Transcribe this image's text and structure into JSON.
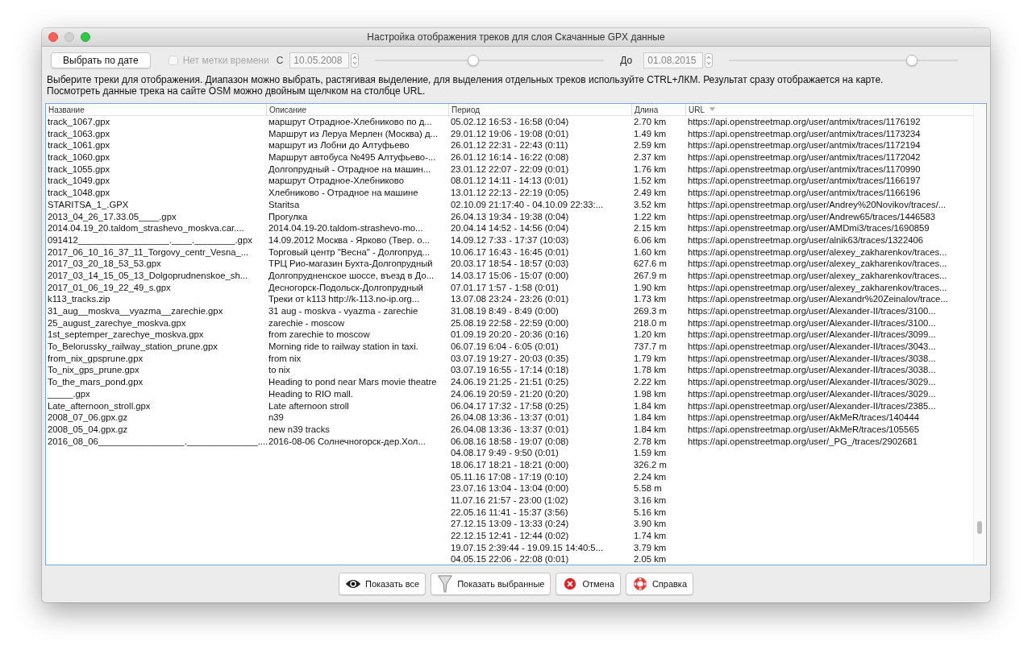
{
  "window": {
    "title": "Настройка отображения треков для слоя Скачанные GPX данные"
  },
  "filter": {
    "date_button": "Выбрать по дате",
    "no_timestamp": {
      "label": "Нет метки времени",
      "checked": false,
      "disabled": true
    },
    "from_label": "С",
    "from_date": "10.05.2008",
    "from_slider": {
      "level": 0.43
    },
    "to_label": "До",
    "to_date": "01.08.2015",
    "to_slider": {
      "level": 0.8
    }
  },
  "instructions": [
    "Выберите треки для отображения. Диапазон можно выбрать, растягивая выделение, для выделения отдельных треков используйте CTRL+ЛКМ. Результат сразу отображается на карте.",
    "Посмотреть данные трека на сайте OSM можно двойным щелчком на столбце URL."
  ],
  "table": {
    "columns": [
      {
        "label": "Название",
        "sorted": false
      },
      {
        "label": "Описание",
        "sorted": false
      },
      {
        "label": "Период",
        "sorted": false
      },
      {
        "label": "Длина",
        "sorted": false
      },
      {
        "label": "URL",
        "sorted": true
      }
    ],
    "rows": [
      {
        "name": "track_1067.gpx",
        "description": "маршрут Отрадное-Хлебниково по д...",
        "period": "05.02.12 16:53 - 16:58 (0:04)",
        "length": "2.70 km",
        "url": "https://api.openstreetmap.org/user/antmix/traces/1176192"
      },
      {
        "name": "track_1063.gpx",
        "description": "Маршрут из Леруа Мерлен (Москва) д...",
        "period": "29.01.12 19:06 - 19:08 (0:01)",
        "length": "1.49 km",
        "url": "https://api.openstreetmap.org/user/antmix/traces/1173234"
      },
      {
        "name": "track_1061.gpx",
        "description": "маршрут из Лобни до Алтуфьево",
        "period": "26.01.12 22:31 - 22:43 (0:11)",
        "length": "2.59 km",
        "url": "https://api.openstreetmap.org/user/antmix/traces/1172194"
      },
      {
        "name": "track_1060.gpx",
        "description": "Маршрут автобуса №495 Алтуфьево-...",
        "period": "26.01.12 16:14 - 16:22 (0:08)",
        "length": "2.37 km",
        "url": "https://api.openstreetmap.org/user/antmix/traces/1172042"
      },
      {
        "name": "track_1055.gpx",
        "description": "Долгопрудный - Отрадное на машин...",
        "period": "23.01.12 22:07 - 22:09 (0:01)",
        "length": "1.76 km",
        "url": "https://api.openstreetmap.org/user/antmix/traces/1170990"
      },
      {
        "name": "track_1049.gpx",
        "description": "маршрут Отрадное-Хлебниково",
        "period": "08.01.12 14:11 - 14:13 (0:01)",
        "length": "1.52 km",
        "url": "https://api.openstreetmap.org/user/antmix/traces/1166197"
      },
      {
        "name": "track_1048.gpx",
        "description": "Хлебниково - Отрадное на машине",
        "period": "13.01.12 22:13 - 22:19 (0:05)",
        "length": "2.49 km",
        "url": "https://api.openstreetmap.org/user/antmix/traces/1166196"
      },
      {
        "name": "STARITSA_1_.GPX",
        "description": "Staritsa",
        "period": "02.10.09 21:17:40 - 04.10.09 22:33:...",
        "length": "3.52 km",
        "url": "https://api.openstreetmap.org/user/Andrey%20Novikov/traces/..."
      },
      {
        "name": "2013_04_26_17.33.05____.gpx",
        "description": "Прогулка",
        "period": "26.04.13 19:34 - 19:38 (0:04)",
        "length": "1.22 km",
        "url": "https://api.openstreetmap.org/user/Andrew65/traces/1446583"
      },
      {
        "name": "2014.04.19_20.taldom_strashevo_moskva.car....",
        "description": "2014.04.19-20.taldom-strashevo-mo...",
        "period": "20.04.14 14:52 - 14:56 (0:04)",
        "length": "2.15 km",
        "url": "https://api.openstreetmap.org/user/AMDmi3/traces/1690859"
      },
      {
        "name": "091412__________________.____.________.gpx",
        "description": "14.09.2012 Москва - Ярково (Твер. о...",
        "period": "14.09.12 7:33 - 17:37 (10:03)",
        "length": "6.06 km",
        "url": "https://api.openstreetmap.org/user/alnik63/traces/1322406"
      },
      {
        "name": "2017_06_10_16_37_11_Torgovy_centr_Vesna_...",
        "description": "Торговый центр \"Весна\" - Долгопруд...",
        "period": "10.06.17 16:43 - 16:45 (0:01)",
        "length": "1.60 km",
        "url": "https://api.openstreetmap.org/user/alexey_zakharenkov/traces..."
      },
      {
        "name": "2017_03_20_18_53_53.gpx",
        "description": "ТРЦ Рио-магазин Бухта-Долгопрудный",
        "period": "20.03.17 18:54 - 18:57 (0:03)",
        "length": "627.6 m",
        "url": "https://api.openstreetmap.org/user/alexey_zakharenkov/traces..."
      },
      {
        "name": "2017_03_14_15_05_13_Dolgoprudnenskoe_sh...",
        "description": "Долгопрудненское шоссе, въезд в До...",
        "period": "14.03.17 15:06 - 15:07 (0:00)",
        "length": "267.9 m",
        "url": "https://api.openstreetmap.org/user/alexey_zakharenkov/traces..."
      },
      {
        "name": "2017_01_06_19_22_49_s.gpx",
        "description": "Десногорск-Подольск-Долгопрудный",
        "period": "07.01.17 1:57 - 1:58 (0:01)",
        "length": "1.90 km",
        "url": "https://api.openstreetmap.org/user/alexey_zakharenkov/traces..."
      },
      {
        "name": "k113_tracks.zip",
        "description": "Треки от k113 http://k-113.no-ip.org...",
        "period": "13.07.08 23:24 - 23:26 (0:01)",
        "length": "1.73 km",
        "url": "https://api.openstreetmap.org/user/Alexandr%20Zeinalov/trace..."
      },
      {
        "name": "31_aug__moskva__vyazma__zarechie.gpx",
        "description": "31 aug - moskva - vyazma - zarechie",
        "period": "31.08.19 8:49 - 8:49 (0:00)",
        "length": "269.3 m",
        "url": "https://api.openstreetmap.org/user/Alexander-II/traces/3100..."
      },
      {
        "name": "25_august_zarechye_moskva.gpx",
        "description": "zarechie - moscow",
        "period": "25.08.19 22:58 - 22:59 (0:00)",
        "length": "218.0 m",
        "url": "https://api.openstreetmap.org/user/Alexander-II/traces/3100..."
      },
      {
        "name": "1st_septemper_zarechye_moskva.gpx",
        "description": "from zarechie to moscow",
        "period": "01.09.19 20:20 - 20:36 (0:16)",
        "length": "1.20 km",
        "url": "https://api.openstreetmap.org/user/Alexander-II/traces/3099..."
      },
      {
        "name": "To_Belorussky_railway_station_prune.gpx",
        "description": "Morning ride to railway station in taxi.",
        "period": "06.07.19 6:04 - 6:05 (0:01)",
        "length": "737.7 m",
        "url": "https://api.openstreetmap.org/user/Alexander-II/traces/3043..."
      },
      {
        "name": "from_nix_gpsprune.gpx",
        "description": "from nix",
        "period": "03.07.19 19:27 - 20:03 (0:35)",
        "length": "1.79 km",
        "url": "https://api.openstreetmap.org/user/Alexander-II/traces/3038..."
      },
      {
        "name": "To_nix_gps_prune.gpx",
        "description": "to nix",
        "period": "03.07.19 16:55 - 17:14 (0:18)",
        "length": "1.78 km",
        "url": "https://api.openstreetmap.org/user/Alexander-II/traces/3038..."
      },
      {
        "name": "To_the_mars_pond.gpx",
        "description": "Heading to pond near Mars movie theatre",
        "period": "24.06.19 21:25 - 21:51 (0:25)",
        "length": "2.22 km",
        "url": "https://api.openstreetmap.org/user/Alexander-II/traces/3029..."
      },
      {
        "name": "_____.gpx",
        "description": "Heading to RIO mall.",
        "period": "24.06.19 20:59 - 21:20 (0:20)",
        "length": "1.98 km",
        "url": "https://api.openstreetmap.org/user/Alexander-II/traces/3029..."
      },
      {
        "name": "Late_afternoon_stroll.gpx",
        "description": "Late afternoon stroll",
        "period": "06.04.17 17:32 - 17:58 (0:25)",
        "length": "1.84 km",
        "url": "https://api.openstreetmap.org/user/Alexander-II/traces/2385..."
      },
      {
        "name": "2008_07_06.gpx.gz",
        "description": "n39",
        "period": "26.04.08 13:36 - 13:37 (0:01)",
        "length": "1.84 km",
        "url": "https://api.openstreetmap.org/user/AkMeR/traces/140444"
      },
      {
        "name": "2008_05_04.gpx.gz",
        "description": "new n39 tracks",
        "period": "26.04.08 13:36 - 13:37 (0:01)",
        "length": "1.84 km",
        "url": "https://api.openstreetmap.org/user/AkMeR/traces/105565"
      },
      {
        "name": "2016_08_06_________________.______________....",
        "description": "2016-08-06 Солнечногорск-дер.Хол...",
        "period": "06.08.16 18:58 - 19:07 (0:08)",
        "length": "2.78 km",
        "url": "https://api.openstreetmap.org/user/_PG_/traces/2902681"
      },
      {
        "period": "04.08.17 9:49 - 9:50 (0:01)",
        "length": "1.59 km"
      },
      {
        "period": "18.06.17 18:21 - 18:21 (0:00)",
        "length": "326.2 m"
      },
      {
        "period": "05.11.16 17:08 - 17:19 (0:10)",
        "length": "2.24 km"
      },
      {
        "period": "23.07.16 13:04 - 13:04 (0:00)",
        "length": "5.58 m"
      },
      {
        "period": "11.07.16 21:57 - 23:00 (1:02)",
        "length": "3.16 km"
      },
      {
        "period": "22.05.16 11:41 - 15:37 (3:56)",
        "length": "5.16 km"
      },
      {
        "period": "27.12.15 13:09 - 13:33 (0:24)",
        "length": "3.90 km"
      },
      {
        "period": "22.12.15 12:41 - 12:44 (0:02)",
        "length": "1.74 km"
      },
      {
        "period": "19.07.15 2:39:44 - 19.09.15 14:40:5...",
        "length": "3.79 km"
      },
      {
        "period": "04.05.15 22:06 - 22:08 (0:01)",
        "length": "2.05 km"
      }
    ]
  },
  "buttons": [
    "Показать все",
    "Показать выбранные",
    "Отмена",
    "Справка"
  ]
}
